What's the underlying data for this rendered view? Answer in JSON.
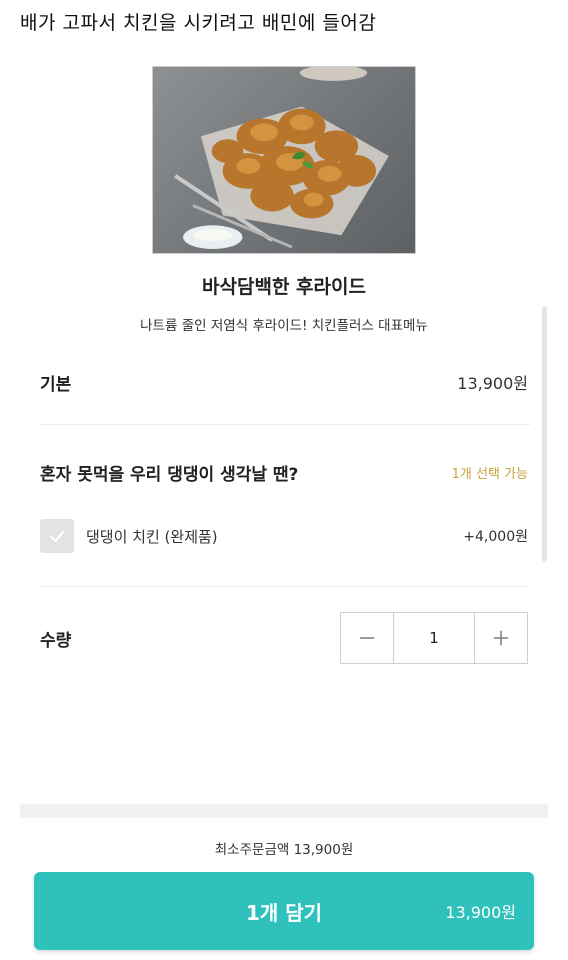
{
  "caption": "배가 고파서 치킨을 시키려고 배민에 들어감",
  "menu": {
    "title": "바삭담백한 후라이드",
    "description": "나트륨 줄인 저염식 후라이드! 치킨플러스 대표메뉴"
  },
  "base": {
    "label": "기본",
    "price": "13,900원"
  },
  "option_group": {
    "title": "혼자 못먹을 우리 댕댕이 생각날 땐?",
    "hint": "1개 선택 가능",
    "options": [
      {
        "label": "댕댕이 치킨 (완제품)",
        "price": "+4,000원",
        "checked": false
      }
    ]
  },
  "quantity": {
    "label": "수량",
    "value": "1",
    "minus_icon": "minus-icon",
    "plus_icon": "plus-icon"
  },
  "min_order": "최소주문금액 13,900원",
  "cta": {
    "label": "1개 담기",
    "price": "13,900원"
  },
  "colors": {
    "accent": "#2fc1bc",
    "hint": "#c8a23c"
  }
}
